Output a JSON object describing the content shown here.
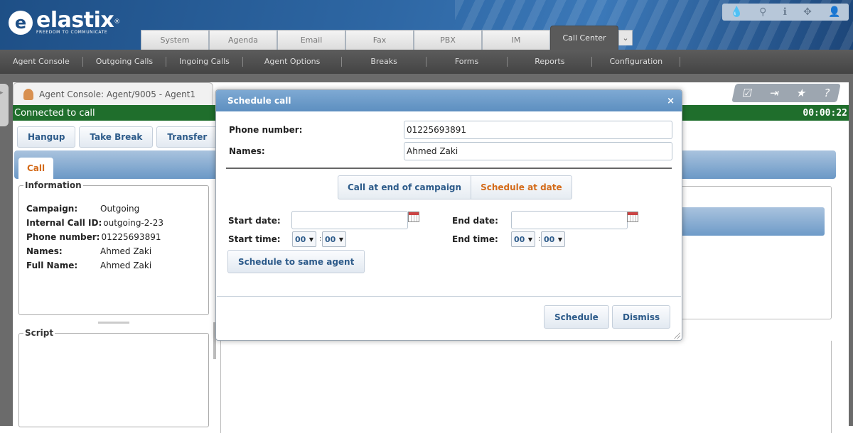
{
  "brand": {
    "name": "elastix",
    "tagline": "FREEDOM TO COMMUNICATE"
  },
  "top_icons": [
    "drop-icon",
    "search-icon",
    "info-icon",
    "plugin-icon",
    "user-icon"
  ],
  "modules": {
    "tabs": [
      "System",
      "Agenda",
      "Email",
      "Fax",
      "PBX",
      "IM",
      "Call Center"
    ],
    "active": "Call Center"
  },
  "subnav": [
    "Agent Console",
    "Outgoing Calls",
    "Ingoing Calls",
    "Agent Options",
    "Breaks",
    "Forms",
    "Reports",
    "Configuration"
  ],
  "console": {
    "tab_title": "Agent Console: Agent/9005 - Agent1",
    "status": "Connected to call",
    "timer": "00:00:22",
    "buttons": {
      "hangup": "Hangup",
      "take_break": "Take Break",
      "transfer": "Transfer"
    },
    "call_tab": "Call",
    "info": {
      "legend": "Information",
      "campaign_label": "Campaign:",
      "campaign": "Outgoing",
      "callid_label": "Internal Call ID:",
      "callid": "outgoing-2-23",
      "phone_label": "Phone number:",
      "phone": "01225693891",
      "names_label": "Names:",
      "names": "Ahmed Zaki",
      "fullname_label": "Full Name:",
      "fullname": "Ahmed Zaki"
    },
    "script_legend": "Script"
  },
  "dialog": {
    "title": "Schedule call",
    "close": "×",
    "phone_label": "Phone number:",
    "phone_value": "01225693891",
    "names_label": "Names:",
    "names_value": "Ahmed Zaki",
    "mode_options": [
      "Call at end of campaign",
      "Schedule at date"
    ],
    "mode_selected": "Schedule at date",
    "start_date_label": "Start date:",
    "end_date_label": "End date:",
    "start_time_label": "Start time:",
    "end_time_label": "End time:",
    "start_hour": "00",
    "start_minute": "00",
    "end_hour": "00",
    "end_minute": "00",
    "time_separator": ":",
    "same_agent_label": "Schedule to same agent",
    "schedule_label": "Schedule",
    "dismiss_label": "Dismiss"
  }
}
